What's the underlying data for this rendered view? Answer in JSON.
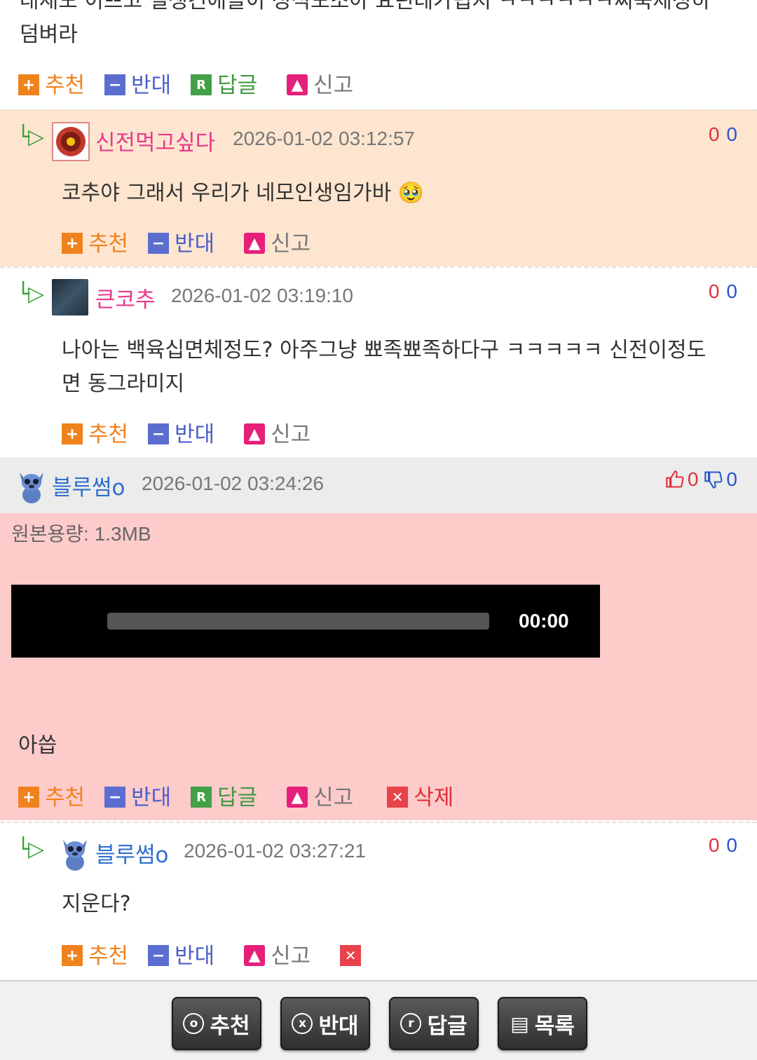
{
  "top_comment": {
    "line1": "대재도 이쁘고 절생긴애들이 정석도조아 요린데가립지 ㅋㅋㅋㅋㅋㅋ찌뚝제정하",
    "line2": "덤벼라",
    "actions": {
      "recommend": "추천",
      "oppose": "반대",
      "reply": "답글",
      "report": "신고"
    }
  },
  "comments": [
    {
      "nick": "신전먹고싶다",
      "date": "2026-01-02 03:12:57",
      "up": "0",
      "down": "0",
      "text": "코추야 그래서 우리가 네모인생임가바 🥹",
      "actions": {
        "recommend": "추천",
        "oppose": "반대",
        "report": "신고"
      }
    },
    {
      "nick": "큰코추",
      "date": "2026-01-02 03:19:10",
      "up": "0",
      "down": "0",
      "text1": "나아는 백육십면체정도? 아주그냥 뾰족뾰족하다구 ㅋㅋㅋㅋㅋ 신전이정도",
      "text2": "면 동그라미지",
      "actions": {
        "recommend": "추천",
        "oppose": "반대",
        "report": "신고"
      }
    },
    {
      "nick": "블루썸o",
      "date": "2026-01-02 03:24:26",
      "up": "0",
      "down": "0",
      "filesize": "원본용량: 1.3MB",
      "video_time": "00:00",
      "text": "아씁",
      "actions": {
        "recommend": "추천",
        "oppose": "반대",
        "reply": "답글",
        "report": "신고",
        "delete": "삭제"
      }
    },
    {
      "nick": "블루썸o",
      "date": "2026-01-02 03:27:21",
      "up": "0",
      "down": "0",
      "text": "지운다?",
      "actions": {
        "recommend": "추천",
        "oppose": "반대",
        "report": "신고"
      }
    }
  ],
  "bottom": {
    "recommend": "추천",
    "oppose": "반대",
    "reply": "답글",
    "list": "목록"
  },
  "colors": {
    "highlight_bg": "#fde5cf",
    "self_bg": "#fecbcb",
    "header_bg": "#ececec",
    "nick_pink": "#e8398c",
    "nick_blue": "#2e6fce"
  }
}
